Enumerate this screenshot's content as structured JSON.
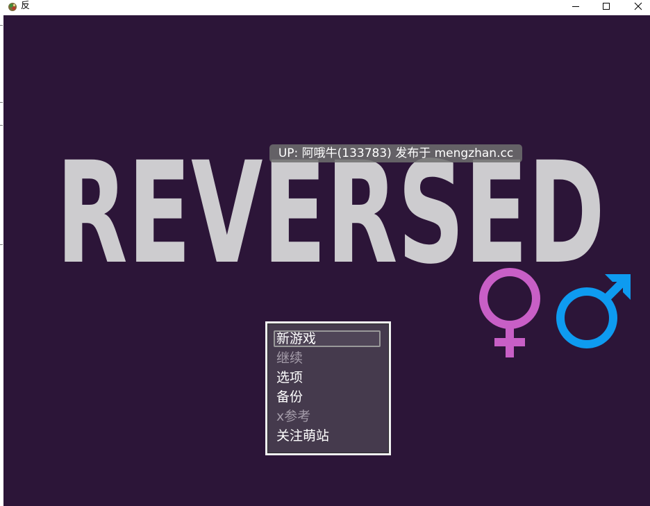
{
  "window": {
    "title": "反",
    "icon": "game-app-icon",
    "controls": [
      "minimize-icon",
      "maximize-icon",
      "close-icon"
    ]
  },
  "game": {
    "background_color": "#2c1538",
    "logo_text": "REVERSED",
    "logo_color": "#cdcccf",
    "up_banner": "UP: 阿哦牛(133783) 发布于 mengzhan.cc",
    "symbols": {
      "female": {
        "icon": "female-symbol-icon",
        "color": "#c85fc6"
      },
      "male": {
        "icon": "male-symbol-icon",
        "color": "#0e9bf0"
      }
    },
    "menu": {
      "selected_index": 0,
      "items": [
        {
          "label": "新游戏",
          "enabled": true
        },
        {
          "label": "继续",
          "enabled": false
        },
        {
          "label": "选项",
          "enabled": true
        },
        {
          "label": "备份",
          "enabled": true
        },
        {
          "label": "x参考",
          "enabled": false
        },
        {
          "label": "关注萌站",
          "enabled": true
        }
      ]
    }
  }
}
